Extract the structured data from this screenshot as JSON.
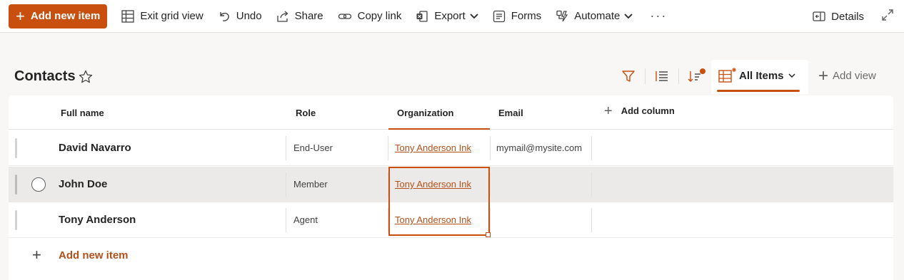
{
  "toolbar": {
    "add_new_item": "Add new item",
    "exit_grid_view": "Exit grid view",
    "undo": "Undo",
    "share": "Share",
    "copy_link": "Copy link",
    "export": "Export",
    "forms": "Forms",
    "automate": "Automate",
    "more": "···",
    "details": "Details"
  },
  "list": {
    "title": "Contacts",
    "view_name": "All Items",
    "add_view": "Add view"
  },
  "columns": {
    "full_name": "Full name",
    "role": "Role",
    "organization": "Organization",
    "email": "Email",
    "add_column": "Add column"
  },
  "rows": [
    {
      "full_name": "David Navarro",
      "role": "End-User",
      "organization": "Tony Anderson Ink",
      "email": "mymail@mysite.com"
    },
    {
      "full_name": "John Doe",
      "role": "Member",
      "organization": "Tony Anderson Ink",
      "email": ""
    },
    {
      "full_name": "Tony Anderson",
      "role": "Agent",
      "organization": "Tony Anderson Ink",
      "email": ""
    }
  ],
  "add_item_label": "Add new item",
  "colors": {
    "accent": "#c84f0e",
    "link": "#b4501a"
  }
}
